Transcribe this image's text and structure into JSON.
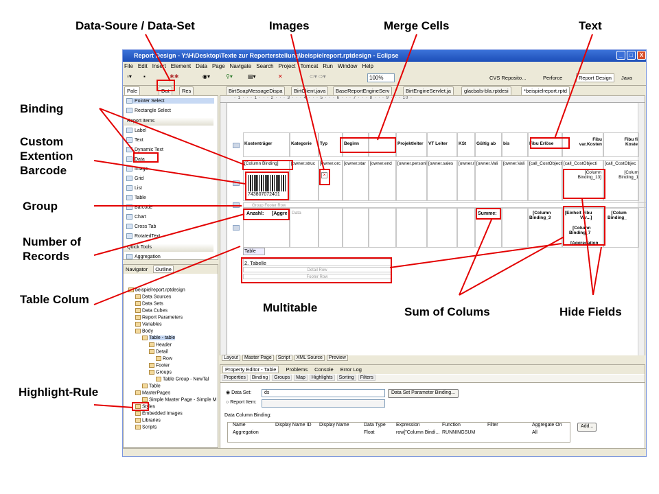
{
  "annotations": {
    "data_source": "Data-Soure / Data-Set",
    "images": "Images",
    "merge_cells": "Merge Cells",
    "text": "Text",
    "binding": "Binding",
    "custom_1": "Custom",
    "custom_2": "Extention",
    "custom_3": "Barcode",
    "group": "Group",
    "number_1": "Number of",
    "number_2": "Records",
    "table_colum": "Table Colum",
    "multitable": "Multitable",
    "sum_of_colums": "Sum of Colums",
    "hide_fields": "Hide Fields",
    "highlight_rule": "Highlight-Rule"
  },
  "window": {
    "title": "Report Design - Y:\\H\\Desktop\\Texte zur Reporterstellung\\beispielreport.rptdesign - Eclipse",
    "minimize": "_",
    "maximize": "□",
    "close": "X"
  },
  "menu": [
    "File",
    "Edit",
    "Insert",
    "Element",
    "Data",
    "Page",
    "Navigate",
    "Search",
    "Project",
    "Tomcat",
    "Run",
    "Window",
    "Help"
  ],
  "toolbar": {
    "zoom": "100%",
    "perspectives": [
      "CVS Reposito...",
      "Perforce",
      "Report Design",
      "Java"
    ]
  },
  "palette_tabs": [
    "Pale",
    "Dat",
    "Res"
  ],
  "editor_tabs": [
    "BirtSoapMessageDispa",
    "BirtClient.java",
    "BaseReportEngineServ",
    "BirtEngineServlet.ja",
    "glacbals-bla.rptdesi",
    "*beispielreport.rptd"
  ],
  "palette": {
    "tools": [
      "Pointer Select",
      "Rectangle Select"
    ],
    "report_items_header": "Report Items",
    "items": [
      "Label",
      "Text",
      "Dynamic Text",
      "Data",
      "Image",
      "Grid",
      "List",
      "Table",
      "Barcode",
      "Chart",
      "Cross Tab",
      "RotatedText"
    ],
    "quick_tools_header": "Quick Tools",
    "quick_items": [
      "Aggregation"
    ]
  },
  "outline_tabs": [
    "Navigator",
    "Outline"
  ],
  "outline": [
    "beispielreport.rptdesign",
    "Data Sources",
    "Data Sets",
    "Data Cubes",
    "Report Parameters",
    "Variables",
    "Body",
    "Table - table",
    "Header",
    "Detail",
    "Row",
    "Footer",
    "Groups",
    "Table Group - NewTal",
    "Table",
    "MasterPages",
    "Simple Master Page - Simple M",
    "Styles",
    "Embedded Images",
    "Libraries",
    "Scripts"
  ],
  "report": {
    "ruler": "· 1 · · · 1 · · · 2 · · · 3 · · · 4 · · · 5 · · · 6 · · · 7 · · · 8 · · · 9 · · · 10 ·",
    "headers": [
      "Kostenträger",
      "Kategorie",
      "Typ",
      "Beginn",
      "",
      "Projektleiter",
      "VT Leiter",
      "KSt",
      "Gültig ab",
      "bis",
      "Fibu Erlöse",
      "Fibu\nvar.Kosten",
      "Fibu fi\nKoste"
    ],
    "detail": [
      "[Column Binding]",
      "[owner.struc",
      "[owner.orc",
      "[owner.star",
      "[owner.end",
      "[owner.personl",
      "[owner.sales",
      "[owner.r",
      "[owner.Vali",
      "[owner.Vali",
      "[call_CostObjecti",
      "[call_CostObjecti",
      "[call_CostObjec"
    ],
    "barcode_number": "743807072401",
    "hidden_1": "[Column\nBinding_13]",
    "hidden_2": "[Colum\nBinding_1",
    "group_footer": "Group Footer Row",
    "count_label": "Anzahl:",
    "count_value": "[Aggre",
    "data_label": "Data",
    "sum_label": "Summe:",
    "footer_1": "[Column\nBinding_3",
    "footer_2": "[Einheit Fibu\nVar...]",
    "footer_3": "[Colum\nBinding_",
    "footer_4": "[Column\nBinding_7",
    "footer_5": "[Aggregation",
    "table2_label": "Table",
    "table2_title": "2. Tabelle",
    "table2_detail": "Detail Row",
    "table2_footer": "Footer Row"
  },
  "bottom_tabs": [
    "Layout",
    "Master Page",
    "Script",
    "XML Source",
    "Preview"
  ],
  "props": {
    "top_tabs": [
      "Property Editor - Table",
      "Problems",
      "Console",
      "Error Log"
    ],
    "sub_tabs": [
      "Properties",
      "Binding",
      "Groups",
      "Map",
      "Highlights",
      "Sorting",
      "Filters"
    ],
    "data_set_label": "Data Set:",
    "data_set_value": "ds",
    "report_item_label": "Report Item:",
    "param_button": "Data Set Parameter Binding...",
    "section": "Data Column Binding:",
    "columns": [
      "Name",
      "Display Name ID",
      "Display Name",
      "Data Type",
      "Expression",
      "Function",
      "Filter",
      "Aggregate On"
    ],
    "row": [
      "Aggregation",
      "",
      "",
      "Float",
      "row[\"Column Bindi...",
      "RUNNINGSUM",
      "",
      "All"
    ],
    "add_button": "Add..."
  }
}
